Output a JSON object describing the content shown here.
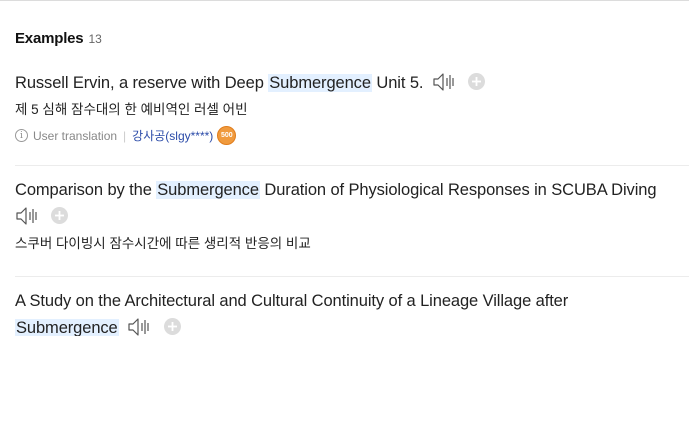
{
  "section": {
    "title": "Examples",
    "count": "13"
  },
  "examples": [
    {
      "pre": "Russell Ervin, a reserve with Deep ",
      "highlight": "Submergence",
      "post": " Unit 5.",
      "translation": "제 5 심해 잠수대의 한 예비역인 러셀 어빈",
      "source_label": "User translation",
      "user": "강사공(slgy****)",
      "badge": "500"
    },
    {
      "pre": "Comparison by the ",
      "highlight": "Submergence",
      "post": " Duration of Physiological Responses in SCUBA Diving",
      "translation": "스쿠버 다이빙시 잠수시간에 따른 생리적 반응의 비교"
    },
    {
      "pre": "A Study on the Architectural and Cultural Continuity of a Lineage Village after ",
      "highlight": "Submergence",
      "post": ""
    }
  ],
  "icons": {
    "speaker": "speaker-icon",
    "plus": "plus-icon",
    "info": "info-icon"
  },
  "colors": {
    "highlight_bg": "#e3f0ff",
    "link": "#2a4aa8",
    "badge": "#f09a3d"
  }
}
